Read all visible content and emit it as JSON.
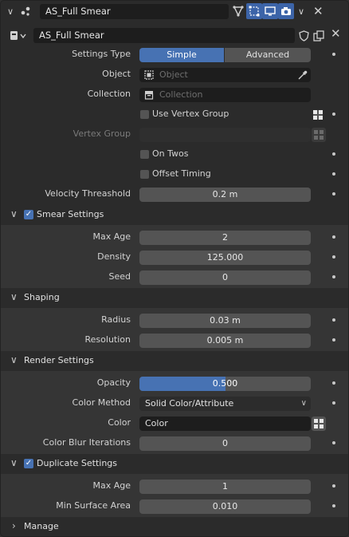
{
  "header": {
    "modifier_name": "AS_Full Smear",
    "node_group_name": "AS_Full Smear"
  },
  "settings_type": {
    "label": "Settings Type",
    "options": [
      "Simple",
      "Advanced"
    ],
    "selected": "Simple"
  },
  "object": {
    "label": "Object",
    "placeholder": "Object"
  },
  "collection": {
    "label": "Collection",
    "placeholder": "Collection"
  },
  "use_vertex_group": {
    "label": "Use Vertex Group",
    "checked": false
  },
  "vertex_group": {
    "label": "Vertex Group",
    "value": ""
  },
  "on_twos": {
    "label": "On Twos",
    "checked": false
  },
  "offset_timing": {
    "label": "Offset Timing",
    "checked": false
  },
  "velocity_threshold": {
    "label": "Velocity Threashold",
    "value": "0.2 m"
  },
  "smear_settings": {
    "title": "Smear Settings",
    "enabled": true,
    "max_age": {
      "label": "Max Age",
      "value": "2"
    },
    "density": {
      "label": "Density",
      "value": "125.000"
    },
    "seed": {
      "label": "Seed",
      "value": "0"
    }
  },
  "shaping": {
    "title": "Shaping",
    "radius": {
      "label": "Radius",
      "value": "0.03 m"
    },
    "resolution": {
      "label": "Resolution",
      "value": "0.005 m"
    }
  },
  "render_settings": {
    "title": "Render Settings",
    "opacity": {
      "label": "Opacity",
      "value": "0.500",
      "fraction": 0.5
    },
    "color_method": {
      "label": "Color Method",
      "value": "Solid Color/Attribute"
    },
    "color": {
      "label": "Color",
      "value": "Color"
    },
    "color_blur_iterations": {
      "label": "Color Blur Iterations",
      "value": "0"
    }
  },
  "duplicate_settings": {
    "title": "Duplicate Settings",
    "enabled": true,
    "max_age": {
      "label": "Max Age",
      "value": "1"
    },
    "min_surface_area": {
      "label": "Min Surface Area",
      "value": "0.010"
    }
  },
  "manage": {
    "title": "Manage"
  },
  "colors": {
    "accent": "#4772b3",
    "panel": "#2b2b2b",
    "field": "#545454"
  }
}
